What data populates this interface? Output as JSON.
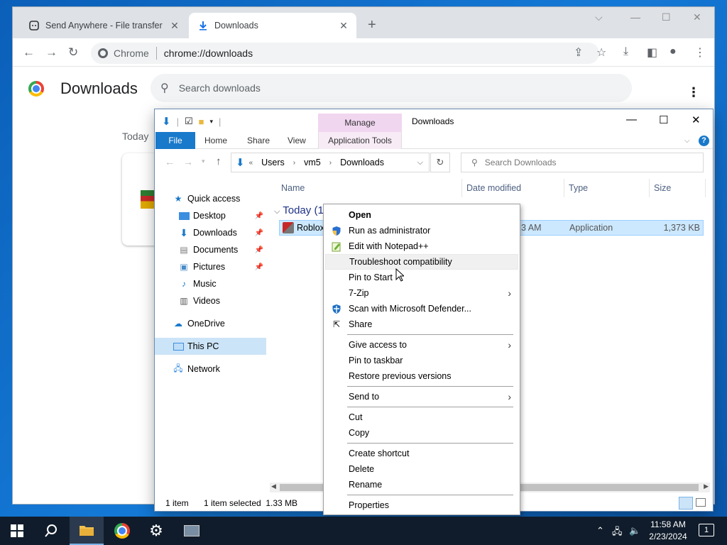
{
  "chrome": {
    "tabs": [
      {
        "label": "Send Anywhere - File transfer",
        "icon": "send-anywhere-icon"
      },
      {
        "label": "Downloads",
        "icon": "download-icon"
      }
    ],
    "omnibox": {
      "site": "Chrome",
      "url": "chrome://downloads"
    },
    "page_title": "Downloads",
    "search_placeholder": "Search downloads",
    "today_label": "Today"
  },
  "explorer": {
    "quick_access_toolbar": [
      "download-icon",
      "properties-icon",
      "new-folder-icon"
    ],
    "manage_tab": "Manage",
    "title": "Downloads",
    "ribbon_tabs": {
      "file": "File",
      "home": "Home",
      "share": "Share",
      "view": "View",
      "app_tools": "Application Tools"
    },
    "address": {
      "prefix": "«",
      "crumbs": [
        "Users",
        "vm5",
        "Downloads"
      ]
    },
    "search_placeholder": "Search Downloads",
    "nav": {
      "quick_access": "Quick access",
      "desktop": "Desktop",
      "downloads": "Downloads",
      "documents": "Documents",
      "pictures": "Pictures",
      "music": "Music",
      "videos": "Videos",
      "onedrive": "OneDrive",
      "this_pc": "This PC",
      "network": "Network"
    },
    "columns": {
      "name": "Name",
      "date": "Date modified",
      "type": "Type",
      "size": "Size"
    },
    "group_header": "Today (1",
    "file": {
      "name": "Roblox",
      "date_partial": "3 AM",
      "type": "Application",
      "size": "1,373 KB"
    },
    "status": {
      "count": "1 item",
      "selected": "1 item selected  1.33 MB"
    }
  },
  "context_menu": {
    "open": "Open",
    "run_as_admin": "Run as administrator",
    "edit_notepad": "Edit with Notepad++",
    "troubleshoot": "Troubleshoot compatibility",
    "pin_start": "Pin to Start",
    "seven_zip": "7-Zip",
    "scan_defender": "Scan with Microsoft Defender...",
    "share": "Share",
    "give_access": "Give access to",
    "pin_taskbar": "Pin to taskbar",
    "restore_versions": "Restore previous versions",
    "send_to": "Send to",
    "cut": "Cut",
    "copy": "Copy",
    "create_shortcut": "Create shortcut",
    "delete": "Delete",
    "rename": "Rename",
    "properties": "Properties"
  },
  "taskbar": {
    "time": "11:58 AM",
    "date": "2/23/2024",
    "notifications": "1"
  },
  "colors": {
    "file_tab": "#1979ca",
    "manage_tab": "#f1d6f0",
    "selection": "#cce8ff",
    "taskbar": "#101c2b"
  }
}
